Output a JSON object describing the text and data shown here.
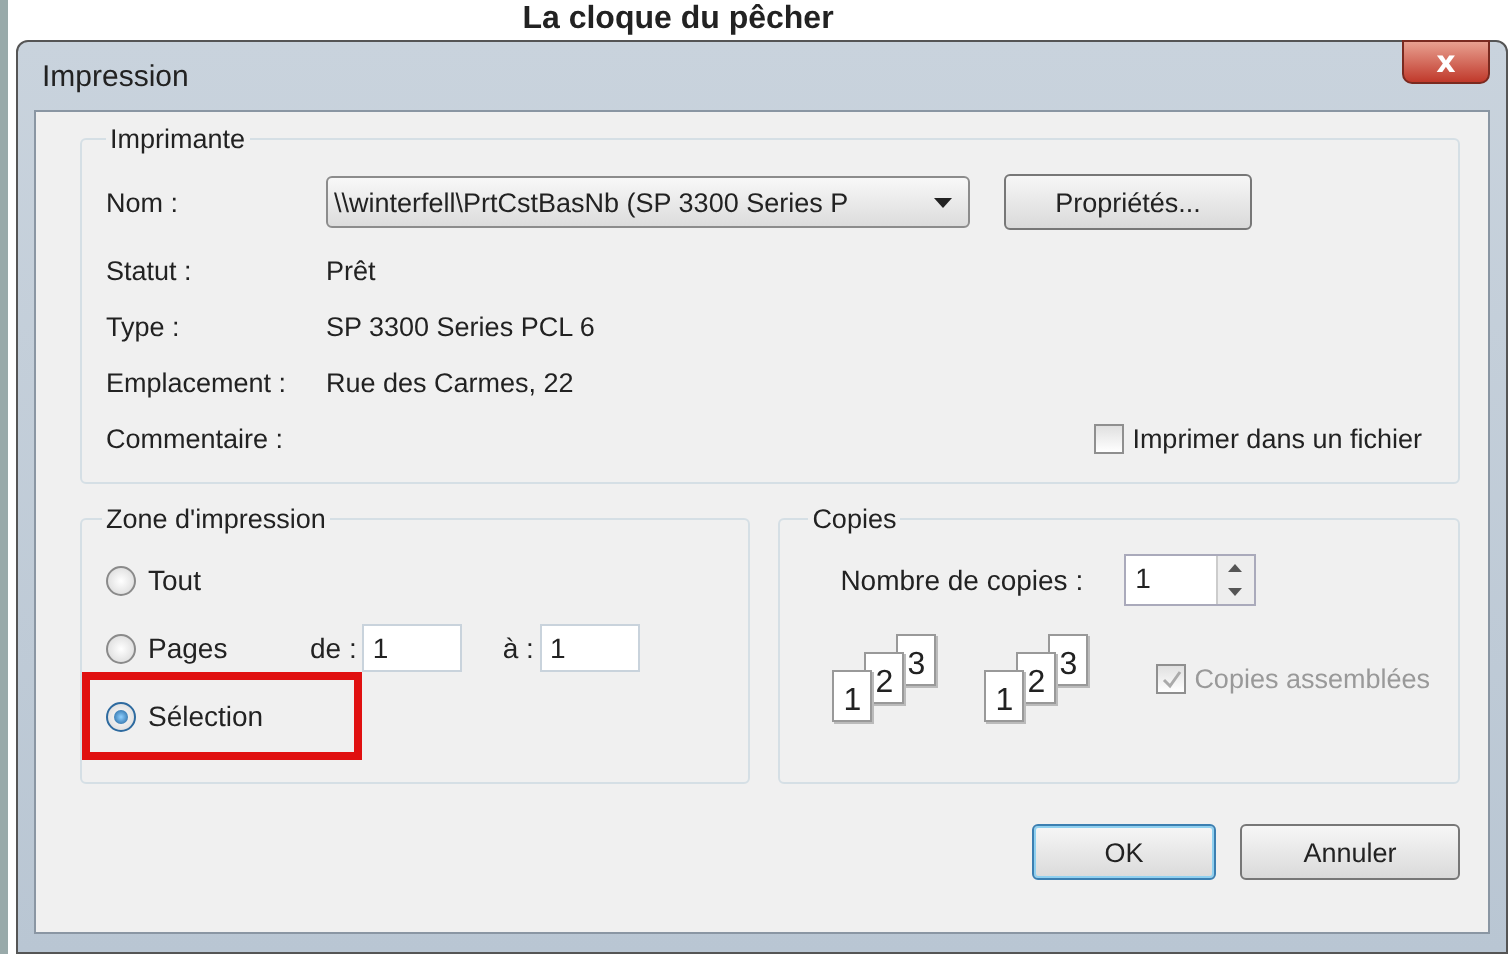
{
  "background_document": {
    "title": "La cloque du pêcher"
  },
  "window": {
    "title": "Impression",
    "close": "x"
  },
  "printer": {
    "legend": "Imprimante",
    "name_label": "Nom :",
    "name_value": "\\\\winterfell\\PrtCstBasNb (SP 3300 Series P",
    "properties_button": "Propriétés...",
    "info": [
      {
        "label": "Statut :",
        "value": "Prêt"
      },
      {
        "label": "Type :",
        "value": "SP 3300 Series PCL 6"
      },
      {
        "label": "Emplacement :",
        "value": "Rue des Carmes, 22"
      },
      {
        "label": "Commentaire :"
      }
    ],
    "print_to_file": {
      "label": "Imprimer dans un fichier",
      "checked": false
    }
  },
  "print_range": {
    "legend": "Zone d'impression",
    "options": [
      {
        "label": "Tout",
        "selected": false,
        "highlighted": false
      },
      {
        "label": "Pages",
        "selected": false,
        "highlighted": false
      },
      {
        "label": "Sélection",
        "selected": true,
        "highlighted": true
      }
    ],
    "from_label": "de :",
    "from_value": "1",
    "to_label": "à :",
    "to_value": "1"
  },
  "copies": {
    "legend": "Copies",
    "count_label": "Nombre de copies :",
    "count_value": "1",
    "stacks": [
      [
        "1",
        "2",
        "3"
      ],
      [
        "1",
        "2",
        "3"
      ]
    ],
    "collate": {
      "label": "Copies assemblées",
      "checked": true,
      "disabled": true
    }
  },
  "buttons": [
    {
      "label": "OK",
      "default": true
    },
    {
      "label": "Annuler",
      "default": false
    }
  ]
}
